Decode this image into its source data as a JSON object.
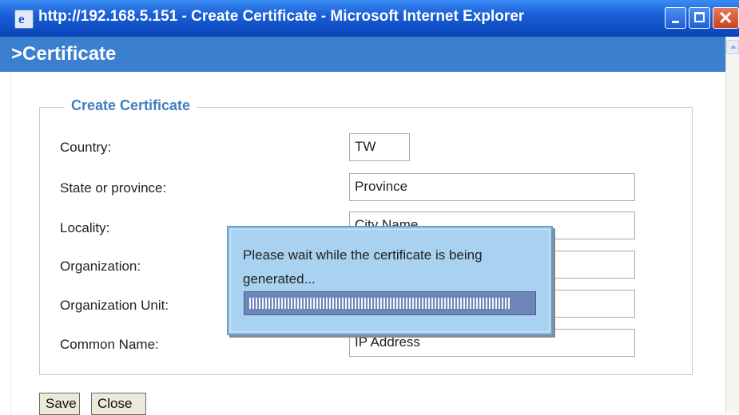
{
  "window": {
    "title": "http://192.168.5.151 - Create Certificate - Microsoft Internet Explorer",
    "icon": "ie-page-icon",
    "controls": [
      "minimize-icon",
      "maximize-icon",
      "close-icon"
    ],
    "colors": {
      "titlebar": "#1a5fd6",
      "close": "#c9431f"
    }
  },
  "header": {
    "title": ">Certificate",
    "color": "#3b7fcf"
  },
  "form": {
    "legend": "Create Certificate",
    "fields": [
      {
        "label": "Country:",
        "value": "TW"
      },
      {
        "label": "State or province:",
        "value": "Province"
      },
      {
        "label": "Locality:",
        "value": "City Name"
      },
      {
        "label": "Organization:",
        "value": ""
      },
      {
        "label": "Organization Unit:",
        "value": ""
      },
      {
        "label": "Common Name:",
        "value": "IP Address"
      }
    ]
  },
  "buttons": {
    "save": "Save",
    "close": "Close"
  },
  "dialog": {
    "message": "Please wait while the certificate is being generated...",
    "progress": 0.93,
    "color": "#a8d2f0"
  }
}
